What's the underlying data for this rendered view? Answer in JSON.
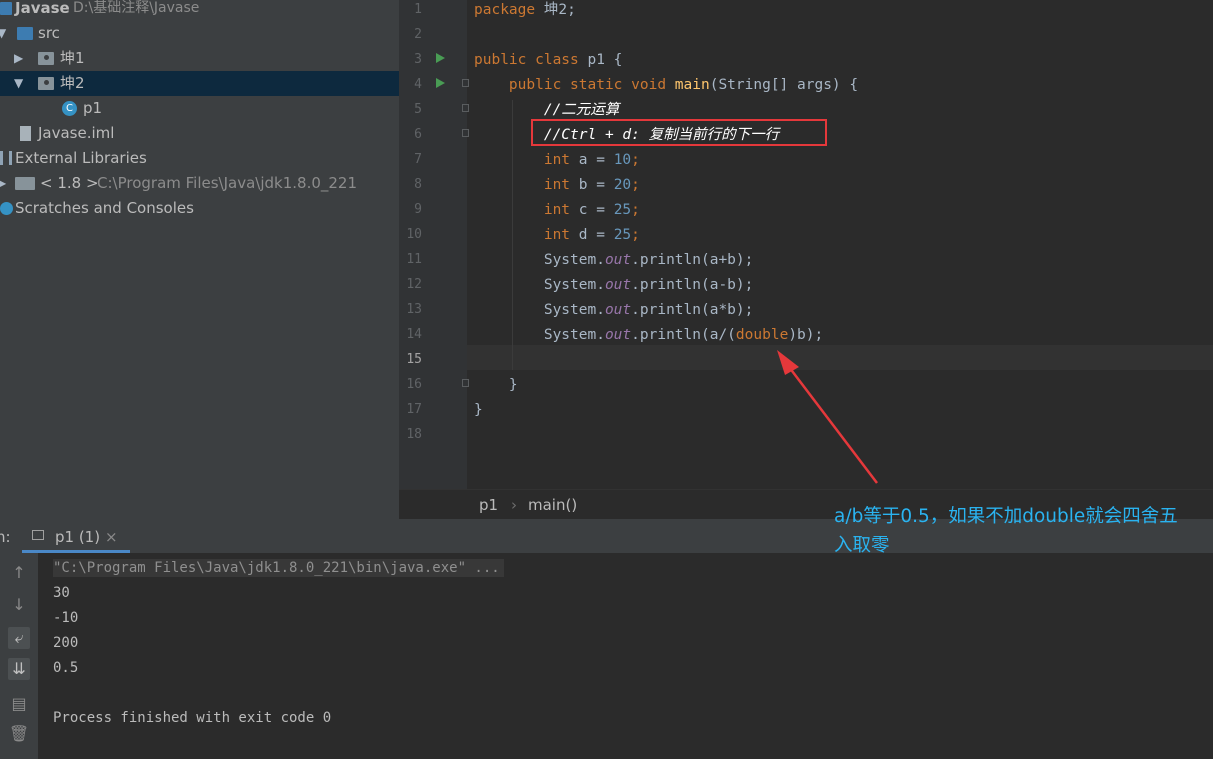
{
  "project_tree": {
    "root_name": "Javase",
    "root_path": "D:\\基础注释\\Javase",
    "src": "src",
    "pkg1": "坤1",
    "pkg2": "坤2",
    "class_p1": "p1",
    "iml": "Javase.iml",
    "external_libraries": "External Libraries",
    "jdk_label": "< 1.8 >",
    "jdk_path": "C:\\Program Files\\Java\\jdk1.8.0_221",
    "scratches": "Scratches and Consoles"
  },
  "editor": {
    "line_numbers": [
      "1",
      "2",
      "3",
      "4",
      "5",
      "6",
      "7",
      "8",
      "9",
      "10",
      "11",
      "12",
      "13",
      "14",
      "15",
      "16",
      "17",
      "18"
    ],
    "code": {
      "l1_kw": "package",
      "l1_rest": " 坤2;",
      "l3_kw": "public class",
      "l3_rest": " p1 {",
      "l4_kw": "public static void",
      "l4_fn": "main",
      "l4_rest": "(String[] args) {",
      "l5": "//二元运算",
      "l6": "//Ctrl + d: 复制当前行的下一行",
      "decls": [
        {
          "type": "int",
          "name": " a = ",
          "value": "10"
        },
        {
          "type": "int",
          "name": " b = ",
          "value": "20"
        },
        {
          "type": "int",
          "name": " c = ",
          "value": "25"
        },
        {
          "type": "int",
          "name": " d = ",
          "value": "25"
        }
      ],
      "sys": "System.",
      "out": "out",
      "prints": [
        ".println(a+b);",
        ".println(a-b);",
        ".println(a*b);"
      ],
      "l14_a": ".println(a/(",
      "l14_kw": "double",
      "l14_b": ")b);",
      "close_brace": "}"
    }
  },
  "breadcrumb": {
    "class": "p1",
    "sep": "›",
    "method": "main()"
  },
  "run_window": {
    "label": "n:",
    "tab": "p1 (1)",
    "close": "×",
    "cmd": "\"C:\\Program Files\\Java\\jdk1.8.0_221\\bin\\java.exe\" ...",
    "output": [
      "30",
      "-10",
      "200",
      "0.5"
    ],
    "finish": "Process finished with exit code 0"
  },
  "annotation": {
    "line1": "a/b等于0.5，如果不加double就会四舍五",
    "line2": "入取零"
  },
  "colors": {
    "keyword": "#cc7832",
    "method": "#ffc66d",
    "number": "#6897bb",
    "field": "#9876aa",
    "highlight_box": "#e5383b",
    "annotation": "#2ab3f0"
  }
}
